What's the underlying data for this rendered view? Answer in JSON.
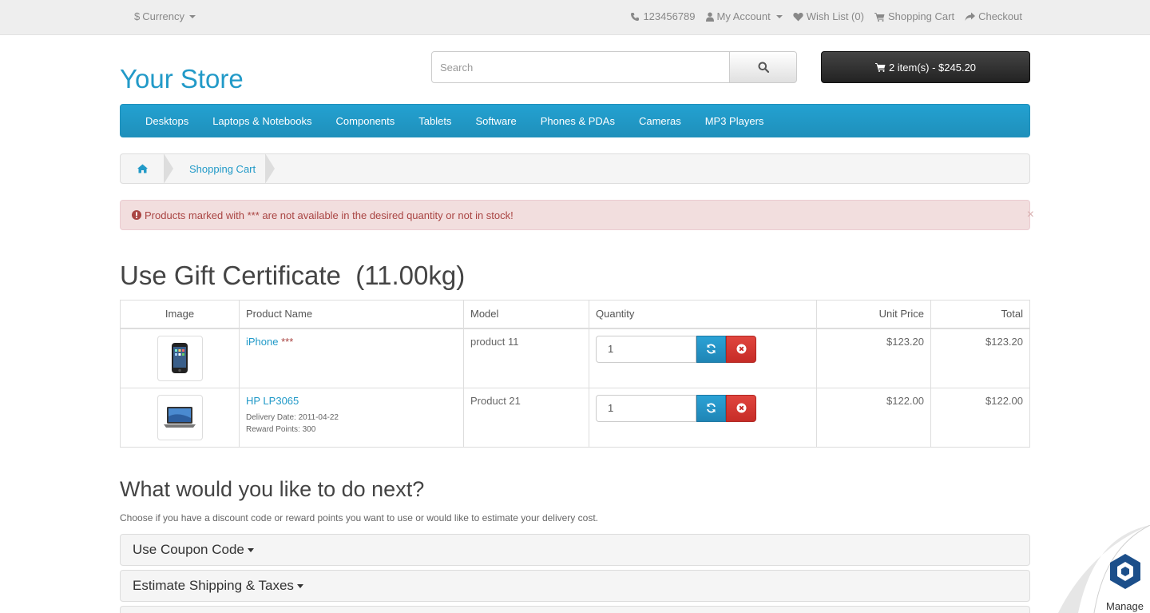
{
  "topbar": {
    "currency_symbol": "$",
    "currency_label": "Currency",
    "phone": "123456789",
    "my_account": "My Account",
    "wish_list": "Wish List (0)",
    "shopping_cart": "Shopping Cart",
    "checkout": "Checkout"
  },
  "header": {
    "logo": "Your Store",
    "search_placeholder": "Search",
    "cart_summary": "2 item(s) - $245.20"
  },
  "menu": [
    "Desktops",
    "Laptops & Notebooks",
    "Components",
    "Tablets",
    "Software",
    "Phones & PDAs",
    "Cameras",
    "MP3 Players"
  ],
  "breadcrumb": {
    "current": "Shopping Cart"
  },
  "alert": {
    "message": "Products marked with *** are not available in the desired quantity or not in stock!",
    "close": "×"
  },
  "page_title": "Use Gift Certificate  (11.00kg)",
  "table": {
    "headers": {
      "image": "Image",
      "name": "Product Name",
      "model": "Model",
      "quantity": "Quantity",
      "unit_price": "Unit Price",
      "total": "Total"
    },
    "rows": [
      {
        "name": "iPhone",
        "stock_flag": "***",
        "model": "product 11",
        "quantity": "1",
        "unit_price": "$123.20",
        "total": "$123.20",
        "delivery": "",
        "reward": ""
      },
      {
        "name": "HP LP3065",
        "stock_flag": "",
        "model": "Product 21",
        "quantity": "1",
        "unit_price": "$122.00",
        "total": "$122.00",
        "delivery": "Delivery Date: 2011-04-22",
        "reward": "Reward Points: 300"
      }
    ]
  },
  "next": {
    "title": "What would you like to do next?",
    "description": "Choose if you have a discount code or reward points you want to use or would like to estimate your delivery cost.",
    "panels": [
      "Use Coupon Code",
      "Estimate Shipping & Taxes"
    ]
  },
  "manage_label": "Manage",
  "colors": {
    "accent": "#229ac8",
    "danger": "#c62c27",
    "cart_button": "#222222",
    "alert_bg": "#f2dede"
  }
}
